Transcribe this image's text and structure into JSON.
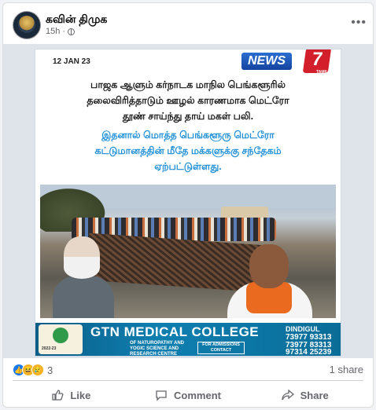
{
  "post": {
    "author": "கவின் திமுக",
    "time": "15h",
    "privacy_icon": "globe-icon",
    "more_icon": "more-options-icon"
  },
  "poster": {
    "date": "12 JAN 23",
    "channel": "NEWS",
    "channel_number": "7",
    "channel_sub": "TAMIL",
    "lines_black": [
      "பாஜக ஆளும் கர்நாடக மாநில பெங்களூரில்",
      "தலைவிரித்தாடும் ஊழல் காரணமாக மெட்ரோ",
      "தூண் சாய்ந்து தாய் மகள் பலி."
    ],
    "lines_blue": [
      "இதனால் மொத்த பெங்களூரு மெட்ரோ",
      "கட்டுமானத்தின் மீதே மக்களுக்கு சந்தேகம்",
      "ஏற்பட்டுள்ளது."
    ],
    "ad": {
      "title": "GTN MEDICAL COLLEGE",
      "subtitle": "OF NATUROPATHY AND YOGIC SCIENCE AND RESEARCH CENTRE",
      "admissions": "FOR ADMISSIONS CONTACT",
      "city": "DINDIGUL",
      "phones": [
        "73977 93313",
        "73977 83313",
        "97314 25239"
      ],
      "year": "2022-23"
    }
  },
  "footer": {
    "reaction_count": "3",
    "shares": "1 share",
    "like_label": "Like",
    "comment_label": "Comment",
    "share_label": "Share"
  }
}
